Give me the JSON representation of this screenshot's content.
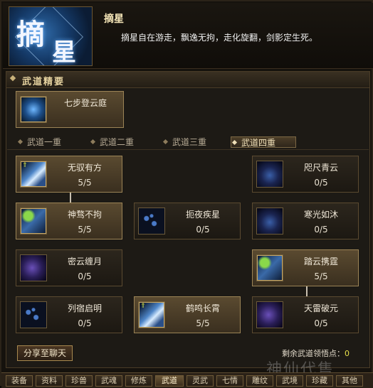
{
  "header": {
    "logo_char_1": "摘",
    "logo_char_2": "星",
    "skill_name": "摘星",
    "skill_description": "摘星自在游走，飘逸无拘，走化旋翻，剑影定生死。"
  },
  "section": {
    "title": "武道精要",
    "core_skill": {
      "name": "七步登云庭",
      "icon": "lightning-figure-icon"
    }
  },
  "tabs": [
    "武道一重",
    "武道二重",
    "武道三重",
    "武道四重"
  ],
  "selected_tab": "武道四重",
  "skills": [
    {
      "name": "无驭有方",
      "level": "5/5",
      "active": true,
      "icon": "wing-icon"
    },
    {
      "name": "咫尺青云",
      "level": "0/5",
      "active": false,
      "icon": "mist-icon"
    },
    {
      "name": "神骛不拘",
      "level": "5/5",
      "active": true,
      "icon": "wing-icon"
    },
    {
      "name": "扼夜疾星",
      "level": "0/5",
      "active": false,
      "icon": "star-dots-icon"
    },
    {
      "name": "寒光如沐",
      "level": "0/5",
      "active": false,
      "icon": "blade-icon"
    },
    {
      "name": "密云缠月",
      "level": "0/5",
      "active": false,
      "icon": "purple-swirl-icon"
    },
    {
      "name": "踏云携霆",
      "level": "5/5",
      "active": true,
      "icon": "wing-icon"
    },
    {
      "name": "列宿启明",
      "level": "0/5",
      "active": false,
      "icon": "star-dots-icon"
    },
    {
      "name": "鹤鸣长霄",
      "level": "5/5",
      "active": true,
      "icon": "wing-icon"
    },
    {
      "name": "天雷破元",
      "level": "0/5",
      "active": false,
      "icon": "purple-swirl-icon"
    }
  ],
  "footer": {
    "share_label": "分享至聊天",
    "remaining_label": "剩余武道领悟点：",
    "remaining_value": "0",
    "watermark": "神仙代售"
  },
  "bottom_tabs": [
    "装备",
    "资料",
    "珍兽",
    "武魂",
    "修炼",
    "武道",
    "灵武",
    "七情",
    "雕纹",
    "武境",
    "珍藏",
    "其他"
  ],
  "selected_bottom_tab": "武道"
}
